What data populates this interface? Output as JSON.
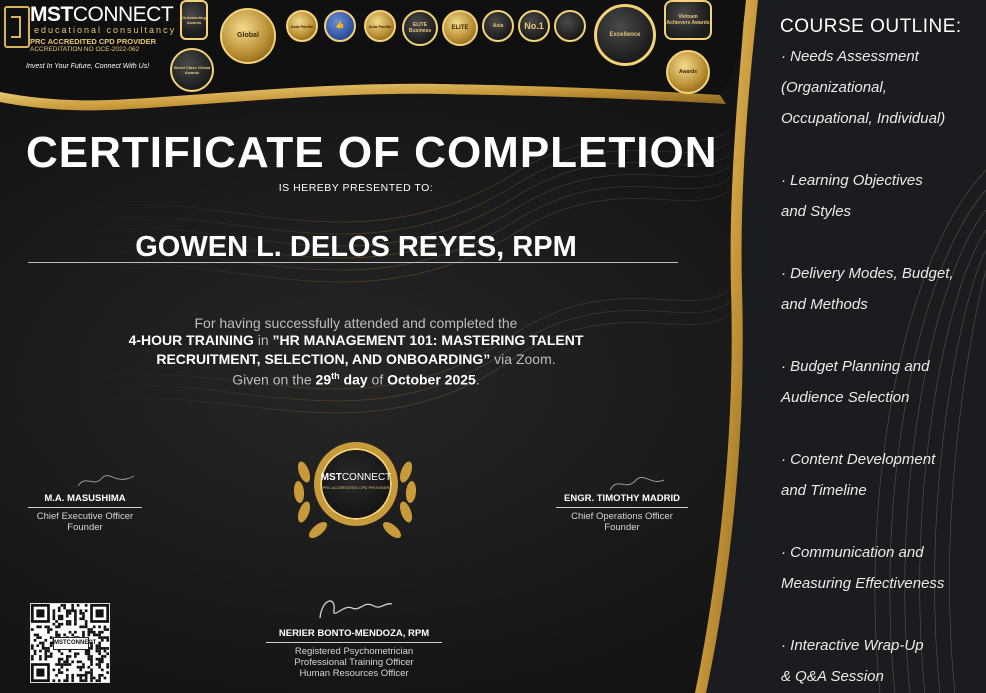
{
  "logo": {
    "brand_bold": "MST",
    "brand_light": "CONNECT",
    "subtitle": "educational consultancy",
    "accreditation_title": "PRC ACCREDITED CPD PROVIDER",
    "accreditation_no": "ACCREDITATION NO OCE-2022-062",
    "tagline": "Invest In Your Future, Connect With Us!"
  },
  "badges": [
    {
      "icon": "trophy-award-icon",
      "label": "Outstanding Awards"
    },
    {
      "icon": "globe-seal-icon",
      "label": "World Class Global Awards"
    },
    {
      "icon": "gold-seal-icon",
      "label": "Global"
    },
    {
      "icon": "gold-seal-icon",
      "label": "Asia Pacific"
    },
    {
      "icon": "thumbs-up-seal-icon",
      "label": ""
    },
    {
      "icon": "star-seal-icon",
      "label": "Asia Pacific"
    },
    {
      "icon": "elite-seal-icon",
      "label": "ELITE Business"
    },
    {
      "icon": "elite-seal-icon",
      "label": "ELITE"
    },
    {
      "icon": "gold-seal-icon",
      "label": "Asia"
    },
    {
      "icon": "no1-seal-icon",
      "label": "No.1"
    },
    {
      "icon": "wreath-seal-icon",
      "label": ""
    },
    {
      "icon": "gold-seal-icon",
      "label": "Excellence"
    },
    {
      "icon": "laurel-award-icon",
      "label": "Vietnam Achievers Awards"
    },
    {
      "icon": "laurel-award-icon",
      "label": "Awards"
    }
  ],
  "certificate": {
    "title": "CERTIFICATE OF COMPLETION",
    "presented_line": "IS HEREBY PRESENTED TO:",
    "recipient": "GOWEN L. DELOS REYES, RPM",
    "body_line1": "For having successfully attended and completed the",
    "training_duration": "4-HOUR TRAINING",
    "in_word": " in ",
    "training_title_part1": "”HR MANAGEMENT 101: MASTERING TALENT",
    "training_title_part2": "RECRUITMENT, SELECTION, AND ONBOARDING”",
    "via": " via Zoom.",
    "given_prefix": "Given on the ",
    "day_number": "29",
    "day_suffix": "th",
    "day_word": " day",
    "of_word": " of ",
    "date": "October 2025",
    "period": "."
  },
  "seal": {
    "brand_bold": "MST",
    "brand_light": "CONNECT",
    "text": "PRC ACCREDITED CPD PROVIDER"
  },
  "signatories": {
    "left": {
      "name": "M.A. MASUSHIMA",
      "role1": "Chief Executive Officer",
      "role2": "Founder"
    },
    "right": {
      "name": "ENGR. TIMOTHY MADRID",
      "role1": "Chief Operations Officer",
      "role2": "Founder"
    },
    "bottom": {
      "name": "NERIER BONTO-MENDOZA, RPM",
      "role1": "Registered Psychometrician",
      "role2": "Professional Training Officer",
      "role3": "Human Resources Officer"
    }
  },
  "qr": {
    "label": "MSTCONNECT"
  },
  "outline": {
    "title": "COURSE OUTLINE:",
    "items": [
      {
        "l1": "· Needs Assessment",
        "l2": "(Organizational,",
        "l3": "Occupational, Individual)"
      },
      {
        "l1": "· Learning Objectives",
        "l2": "and Styles"
      },
      {
        "l1": "· Delivery Modes, Budget,",
        "l2": "and Methods"
      },
      {
        "l1": "· Budget Planning and",
        "l2": "Audience Selection"
      },
      {
        "l1": "· Content Development",
        "l2": "and Timeline"
      },
      {
        "l1": "· Communication and",
        "l2": "Measuring Effectiveness"
      },
      {
        "l1": "· Interactive Wrap-Up",
        "l2": "& Q&A Session"
      }
    ]
  },
  "colors": {
    "gold": "#d9b25c",
    "background": "#161616",
    "text": "#ffffff"
  }
}
